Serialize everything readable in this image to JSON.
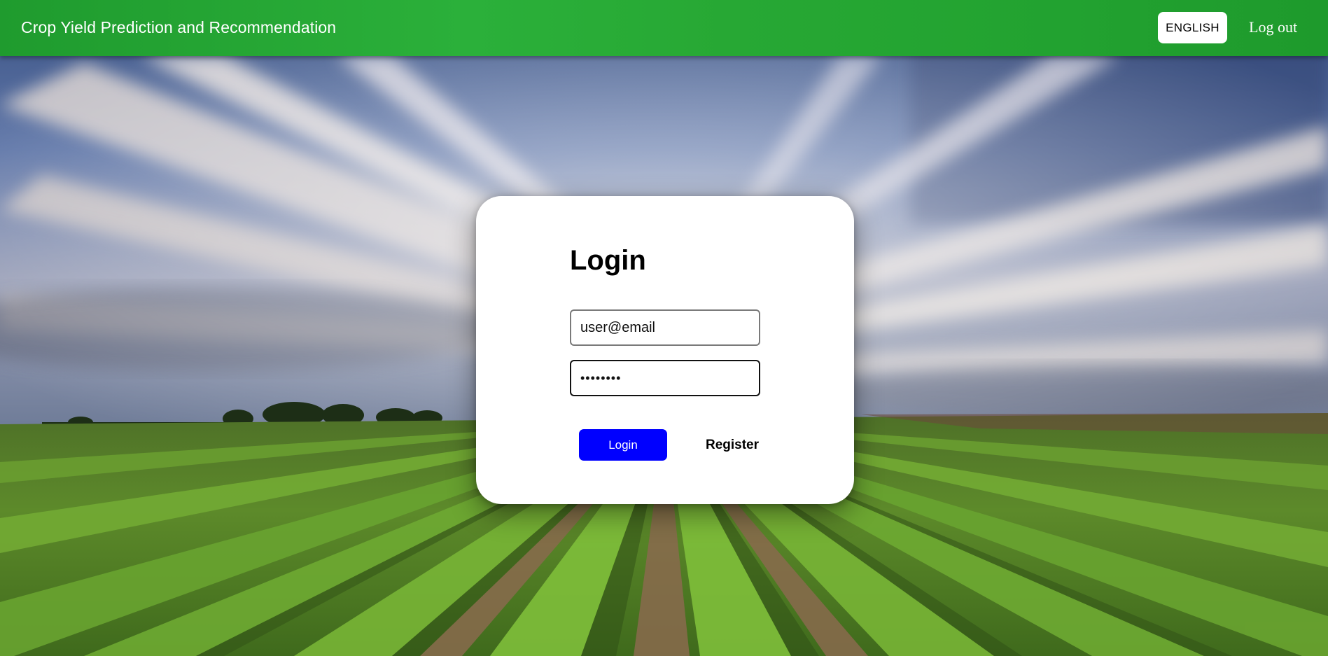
{
  "header": {
    "title": "Crop Yield Prediction and Recommendation",
    "language_label": "ENGLISH",
    "logout_label": "Log out"
  },
  "login": {
    "heading": "Login",
    "email_value": "user@email",
    "password_value": "••••••••",
    "login_label": "Login",
    "register_label": "Register"
  },
  "colors": {
    "header_green": "#27a834",
    "login_button_blue": "#0000ff",
    "card_white": "#ffffff"
  },
  "background": {
    "scene": "long-exposure sky over green crop field rows"
  }
}
